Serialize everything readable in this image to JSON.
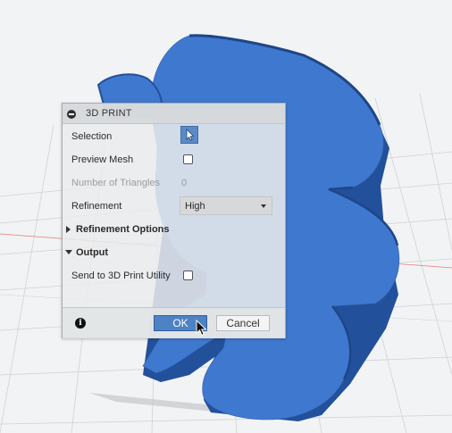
{
  "dialog": {
    "title": "3D PRINT",
    "selection_label": "Selection",
    "preview_mesh_label": "Preview Mesh",
    "preview_mesh_checked": false,
    "triangles_label": "Number of Triangles",
    "triangles_value": "0",
    "refinement_label": "Refinement",
    "refinement_value": "High",
    "refinement_options_label": "Refinement Options",
    "refinement_options_expanded": false,
    "output_label": "Output",
    "output_expanded": true,
    "send_label": "Send to 3D Print Utility",
    "send_checked": false,
    "ok_label": "OK",
    "cancel_label": "Cancel"
  },
  "icons": {
    "collapse": "minus-circle-icon",
    "select": "pointer-arrow-icon",
    "info": "info-icon",
    "cursor": "mouse-cursor-icon"
  },
  "colors": {
    "model_blue": "#3f78cf",
    "ok_button": "#4d82c4",
    "select_button": "#5b8ac8"
  }
}
